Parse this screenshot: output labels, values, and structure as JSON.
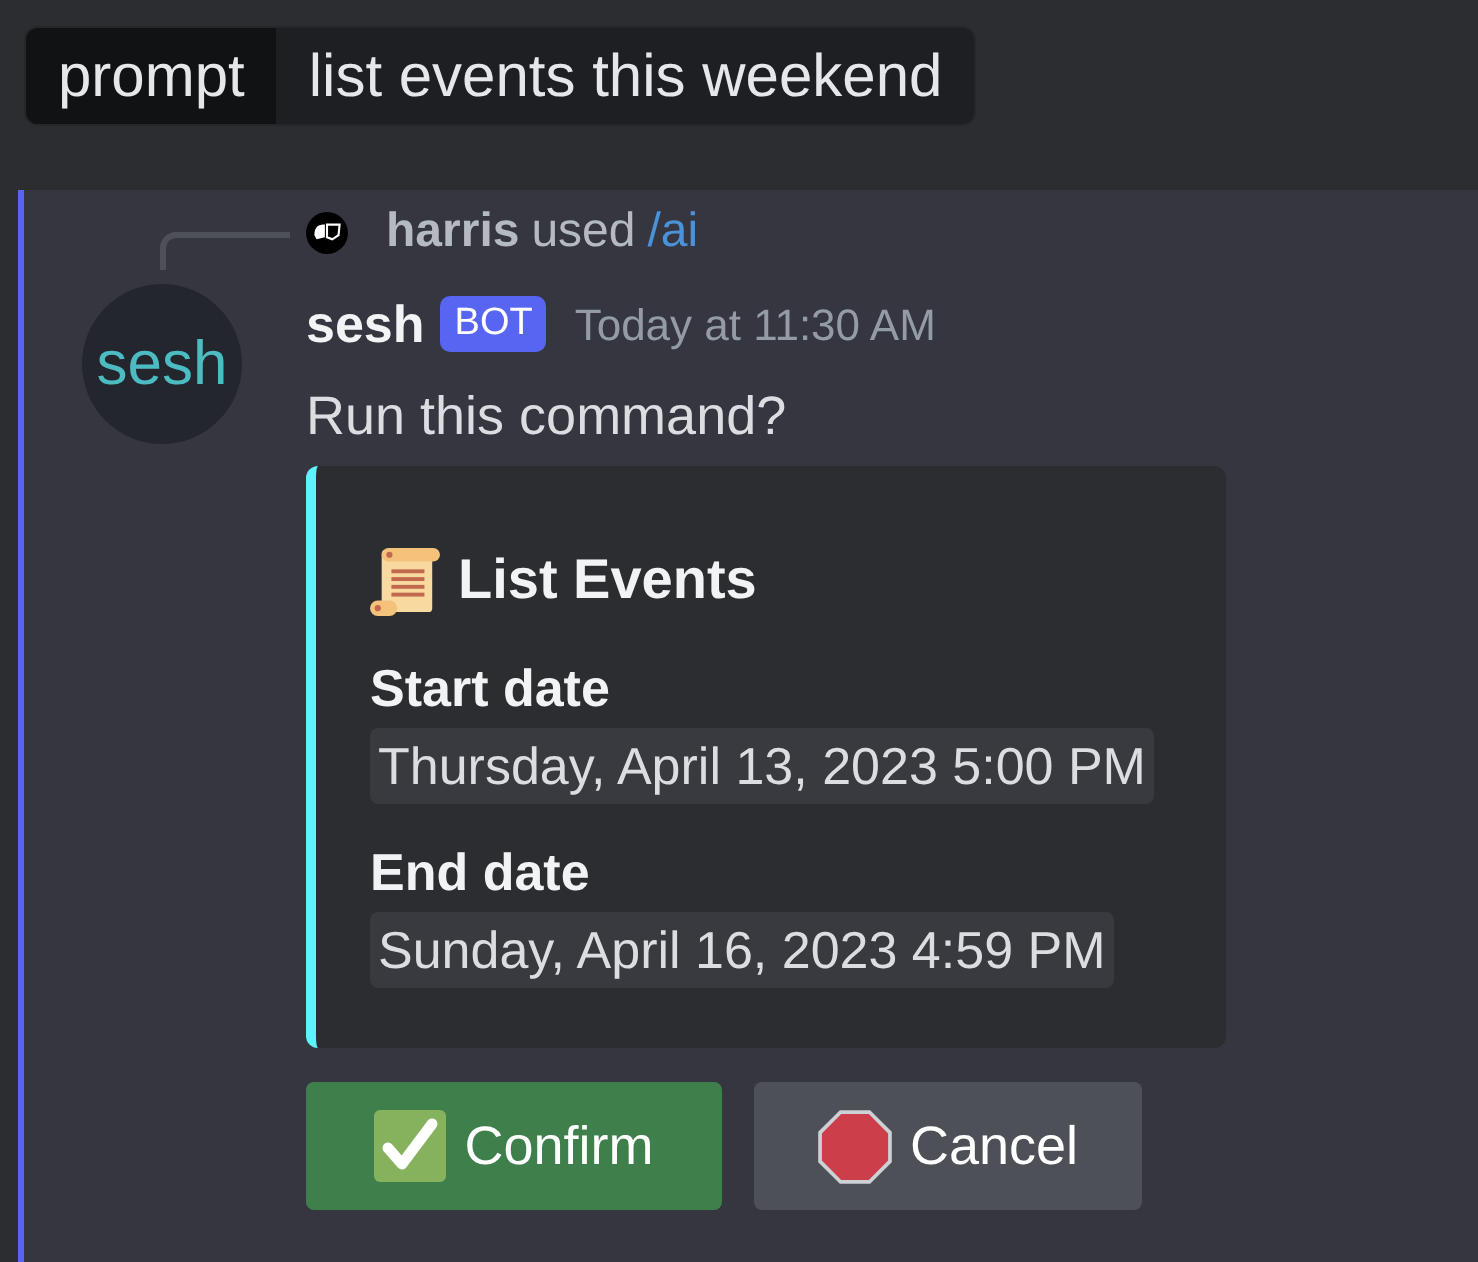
{
  "prompt_bar": {
    "label": "prompt",
    "value": "list events this weekend"
  },
  "message": {
    "reply": {
      "user": "harris",
      "action": "used",
      "command": "/ai"
    },
    "author": {
      "avatar_text": "sesh",
      "name": "sesh",
      "badge": "BOT",
      "timestamp": "Today at 11:30 AM"
    },
    "content": "Run this command?",
    "embed": {
      "title": "List Events",
      "fields": [
        {
          "name": "Start date",
          "value": "Thursday, April 13, 2023 5:00 PM"
        },
        {
          "name": "End date",
          "value": "Sunday, April 16, 2023 4:59 PM"
        }
      ]
    },
    "buttons": [
      {
        "label": "Confirm",
        "kind": "success"
      },
      {
        "label": "Cancel",
        "kind": "secondary"
      }
    ]
  }
}
